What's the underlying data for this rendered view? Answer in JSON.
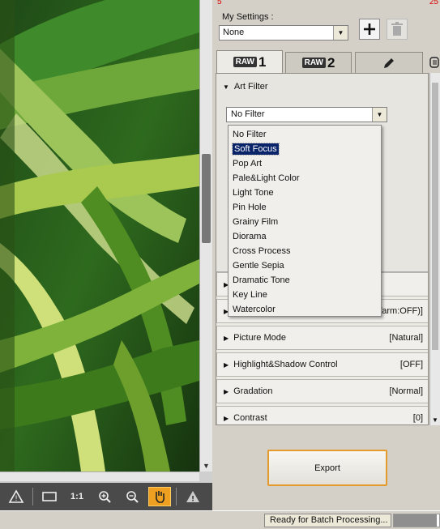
{
  "corner": {
    "left": "5",
    "right": "25"
  },
  "my_settings": {
    "label": "My Settings :",
    "value": "None"
  },
  "tabs": [
    {
      "badge": "RAW",
      "num": "1"
    },
    {
      "badge": "RAW",
      "num": "2"
    }
  ],
  "art_filter": {
    "title": "Art Filter",
    "selected": "No Filter",
    "options": [
      "No Filter",
      "Soft Focus",
      "Pop Art",
      "Pale&Light Color",
      "Light Tone",
      "Pin Hole",
      "Grainy Film",
      "Diorama",
      "Cross Process",
      "Gentle Sepia",
      "Dramatic Tone",
      "Key Line",
      "Watercolor"
    ],
    "highlighted_index": 1
  },
  "sections": [
    {
      "label": "Picture Mode",
      "value": "[Natural]"
    },
    {
      "label": "Highlight&Shadow Control",
      "value": "[OFF]"
    },
    {
      "label": "Gradation",
      "value": "[Normal]"
    },
    {
      "label": "Contrast",
      "value": "[0]"
    }
  ],
  "hidden_rows": {
    "row1_value": "",
    "row2_value": "Warm:OFF)]"
  },
  "export_label": "Export",
  "status": {
    "text": "Ready for Batch Processing...",
    "progress": 0.95
  },
  "toolbar": {
    "one_to_one": "1:1"
  },
  "colors": {
    "accent": "#e49b2b",
    "selection": "#0a246a"
  }
}
